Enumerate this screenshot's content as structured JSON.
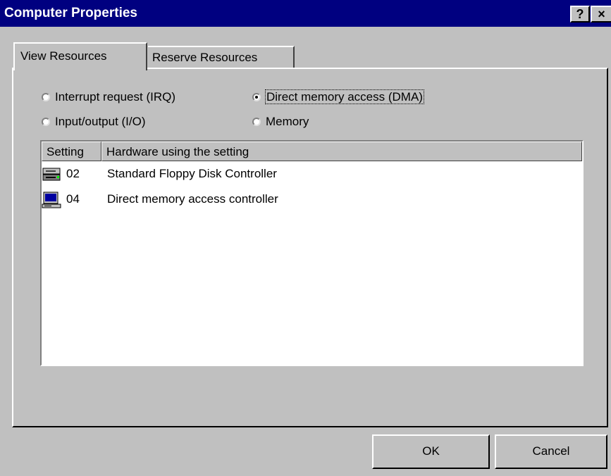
{
  "window": {
    "title": "Computer Properties",
    "help_glyph": "?",
    "close_glyph": "×"
  },
  "tabs": [
    {
      "label": "View Resources",
      "active": true
    },
    {
      "label": "Reserve Resources",
      "active": false
    }
  ],
  "radios": [
    {
      "label": "Interrupt request (IRQ)",
      "selected": false
    },
    {
      "label": "Direct memory access (DMA)",
      "selected": true
    },
    {
      "label": "Input/output (I/O)",
      "selected": false
    },
    {
      "label": "Memory",
      "selected": false
    }
  ],
  "list": {
    "columns": [
      "Setting",
      "Hardware using the setting"
    ],
    "rows": [
      {
        "setting": "02",
        "hardware": "Standard Floppy Disk Controller",
        "icon": "floppy-drive-icon"
      },
      {
        "setting": "04",
        "hardware": "Direct memory access controller",
        "icon": "computer-icon"
      }
    ]
  },
  "buttons": {
    "ok": "OK",
    "cancel": "Cancel"
  },
  "colors": {
    "titlebar": "#000080",
    "face": "#c0c0c0",
    "list_bg": "#ffffff"
  }
}
